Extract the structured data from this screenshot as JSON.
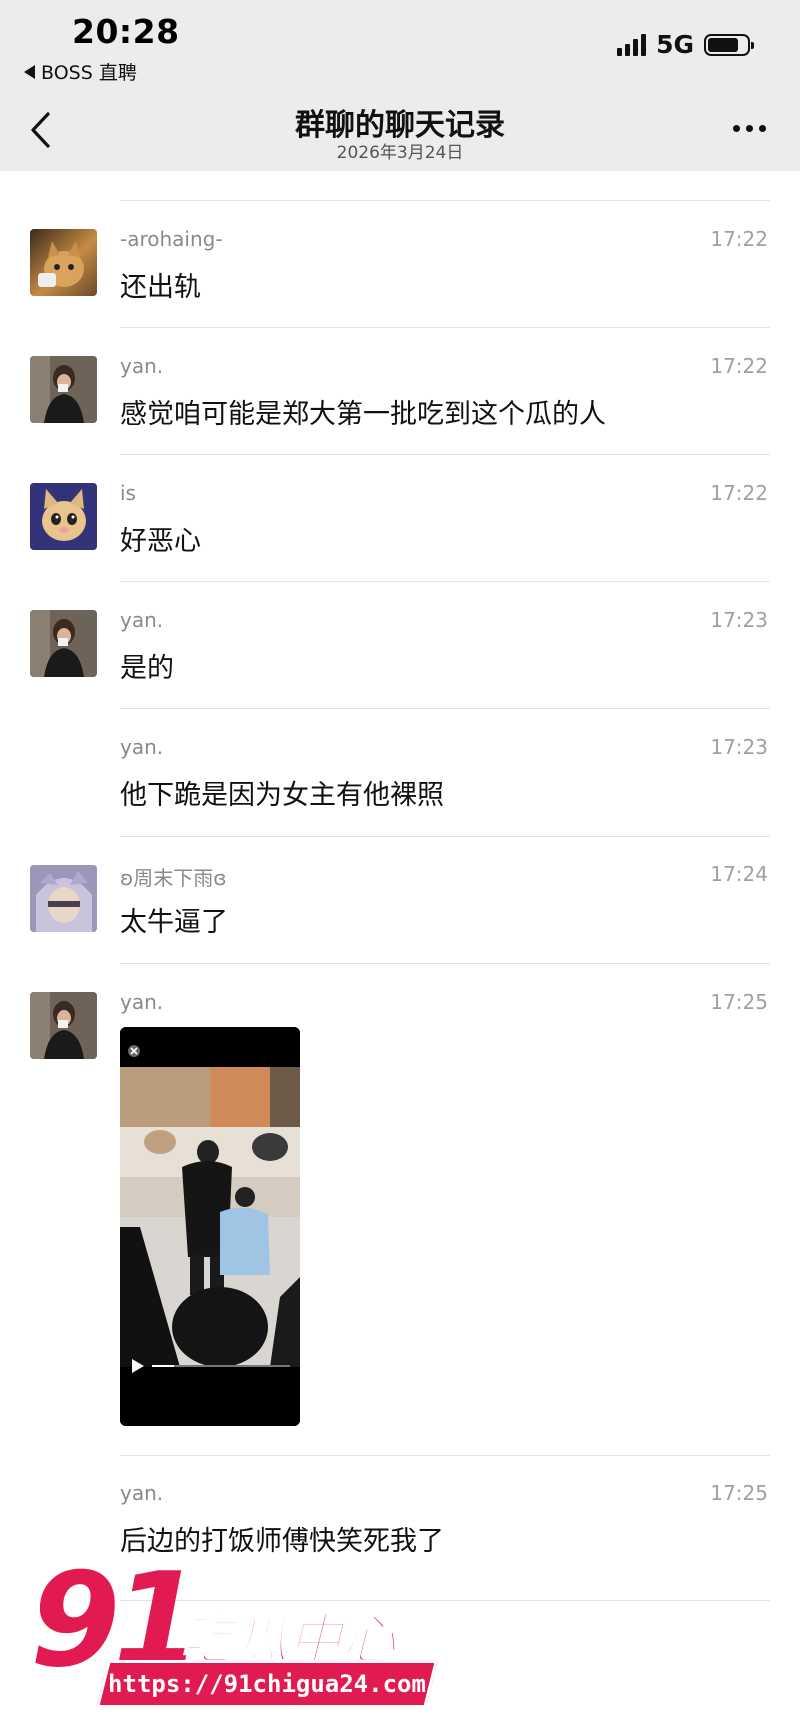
{
  "status_bar": {
    "time": "20:28",
    "back_app": "BOSS 直聘",
    "network": "5G"
  },
  "header": {
    "title": "群聊的聊天记录",
    "date": "2026年3月24日"
  },
  "messages": [
    {
      "sender": "-arohaing-",
      "time": "17:22",
      "text": "还出轨",
      "avatar": "cat-avatar"
    },
    {
      "sender": "yan.",
      "time": "17:22",
      "text": "感觉咱可能是郑大第一批吃到这个瓜的人",
      "avatar": "girl-photo-avatar"
    },
    {
      "sender": "is",
      "time": "17:22",
      "text": "好恶心",
      "avatar": "kitten-avatar"
    },
    {
      "sender": "yan.",
      "time": "17:23",
      "text": "是的",
      "avatar": "girl-photo-avatar"
    },
    {
      "sender": "yan.",
      "time": "17:23",
      "text": "他下跪是因为女主有他裸照",
      "avatar": ""
    },
    {
      "sender": "ʚ周末下雨ɞ",
      "time": "17:24",
      "text": "太牛逼了",
      "avatar": "anime-avatar"
    },
    {
      "sender": "yan.",
      "time": "17:25",
      "text": "",
      "avatar": "girl-photo-avatar",
      "video": true
    },
    {
      "sender": "yan.",
      "time": "17:25",
      "text": "后边的打饭师傅快笑死我了",
      "avatar": ""
    }
  ],
  "watermark": {
    "number": "91",
    "word": "吃瓜中心",
    "url": "https://91chigua24.com"
  },
  "colors": {
    "header_bg": "#ececec",
    "watermark": "#e21a52"
  }
}
